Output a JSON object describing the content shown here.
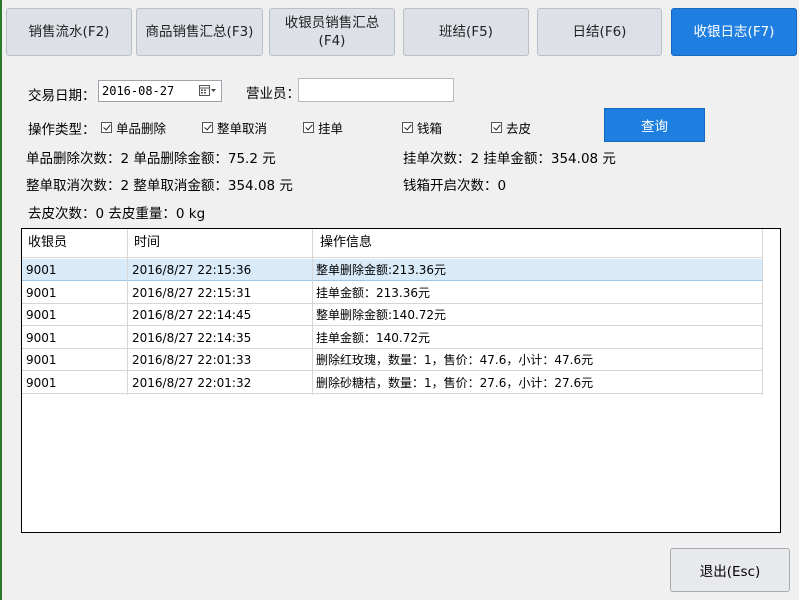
{
  "tabs": [
    {
      "label": "销售流水(F2)"
    },
    {
      "label": "商品销售汇总(F3)"
    },
    {
      "label": "收银员销售汇总\n(F4)"
    },
    {
      "label": "班结(F5)"
    },
    {
      "label": "日结(F6)"
    },
    {
      "label": "收银日志(F7)",
      "active": true
    }
  ],
  "filters": {
    "date_label": "交易日期：",
    "date_value": "2016-08-27",
    "clerk_label": "营业员：",
    "clerk_value": "",
    "op_type_label": "操作类型：",
    "checkboxes": [
      {
        "label": "单品删除",
        "checked": true
      },
      {
        "label": "整单取消",
        "checked": true
      },
      {
        "label": "挂单",
        "checked": true
      },
      {
        "label": "钱箱",
        "checked": true
      },
      {
        "label": "去皮",
        "checked": true
      }
    ],
    "query_label": "查询"
  },
  "stats": {
    "item_delete": "单品删除次数：2  单品删除金额：75.2 元",
    "suspend": "挂单次数：2  挂单金额：354.08 元",
    "order_cancel": "整单取消次数：2  整单取消金额：354.08 元",
    "drawer": "钱箱开启次数：0",
    "tare": "去皮次数：0  去皮重量：0 kg"
  },
  "table": {
    "columns": [
      "收银员",
      "时间",
      "操作信息"
    ],
    "rows": [
      [
        "9001",
        "2016/8/27 22:15:36",
        "整单删除金额:213.36元"
      ],
      [
        "9001",
        "2016/8/27 22:15:31",
        "挂单金额：213.36元"
      ],
      [
        "9001",
        "2016/8/27 22:14:45",
        "整单删除金额:140.72元"
      ],
      [
        "9001",
        "2016/8/27 22:14:35",
        "挂单金额：140.72元"
      ],
      [
        "9001",
        "2016/8/27 22:01:33",
        "删除红玫瑰，数量：1，售价：47.6，小计：47.6元"
      ],
      [
        "9001",
        "2016/8/27 22:01:32",
        "删除砂糖桔，数量：1，售价：27.6，小计：27.6元"
      ]
    ],
    "selected_row": 0
  },
  "exit_label": "退出(Esc)",
  "colors": {
    "accent": "#1e7fe0",
    "selection": "#d9ebf9"
  }
}
